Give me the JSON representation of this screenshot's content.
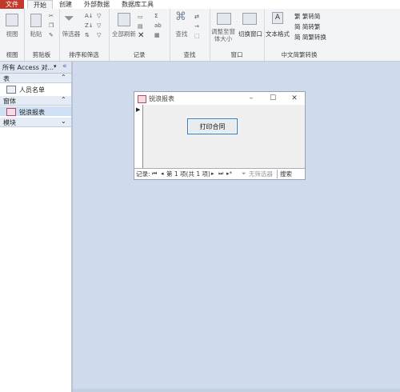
{
  "menubar": {
    "tabs": [
      {
        "label": "文件"
      },
      {
        "label": "开始"
      },
      {
        "label": "创建"
      },
      {
        "label": "外部数据"
      },
      {
        "label": "数据库工具"
      }
    ]
  },
  "ribbon": {
    "groups": [
      {
        "label": "视图",
        "buttons": [
          "视图"
        ]
      },
      {
        "label": "剪贴板",
        "buttons": [
          "粘贴"
        ]
      },
      {
        "label": "排序和筛选",
        "buttons": [
          "筛选器"
        ]
      },
      {
        "label": "记录",
        "buttons": [
          "全部刷新"
        ]
      },
      {
        "label": "查找",
        "buttons": [
          "查找"
        ]
      },
      {
        "label": "窗口",
        "buttons": [
          "调整至窗体大小",
          "切换窗口"
        ]
      },
      {
        "label": "中文简繁转换",
        "buttons": [
          "文本格式",
          "繁转简",
          "简转繁",
          "简繁转换"
        ]
      }
    ]
  },
  "nav": {
    "header": "所有 Access 对...",
    "sections": [
      {
        "title": "表",
        "items": [
          "人员名单"
        ]
      },
      {
        "title": "窗体",
        "items": [
          "锐浪报表"
        ]
      },
      {
        "title": "模块",
        "items": []
      }
    ]
  },
  "form": {
    "title": "锐浪报表",
    "button_label": "打印合同",
    "record_label": "记录:",
    "record_position": "第 1 项(共 1 项)",
    "filter_label": "无筛选器",
    "search_label": "搜索"
  }
}
